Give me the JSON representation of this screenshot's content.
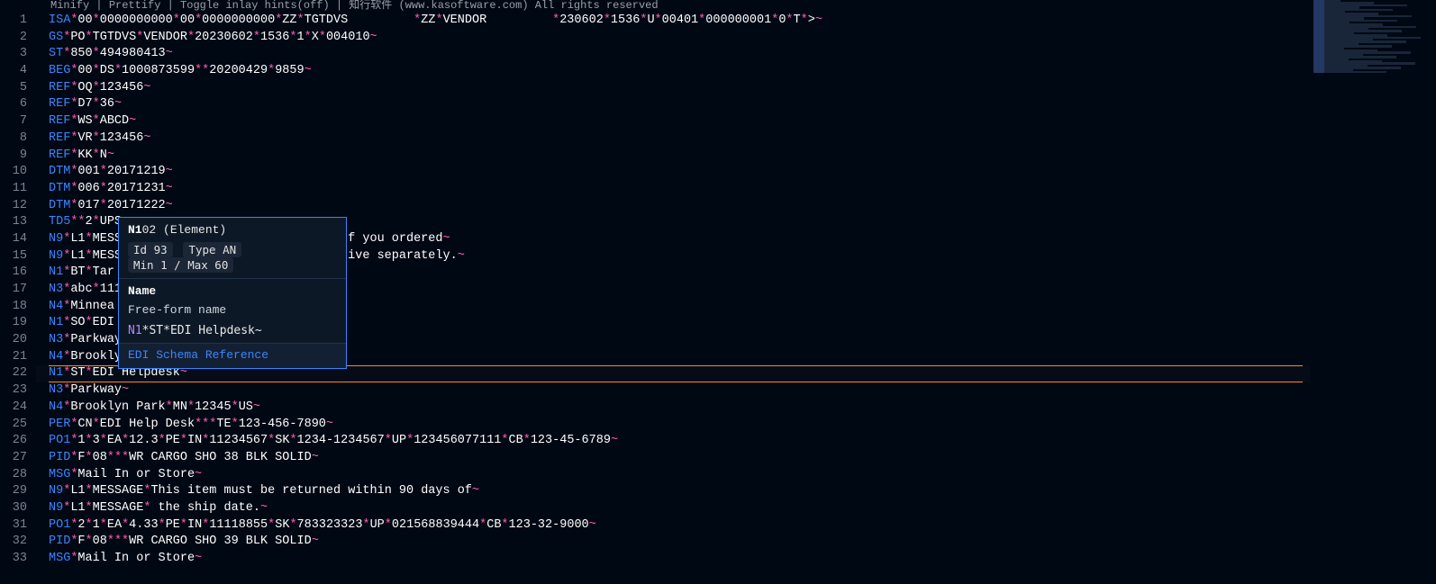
{
  "toolbar": {
    "minify": "Minify",
    "prettify": "Prettify",
    "inlay": "Toggle inlay hints(off)",
    "brand": "知行软件 (www.kasoftware.com) All rights reserved"
  },
  "hover": {
    "title_b": "N1",
    "title_rest": "02 (Element)",
    "badge_id": "Id 93",
    "badge_type": "Type AN",
    "badge_minmax": "Min 1 / Max 60",
    "label_name": "Name",
    "desc": "Free-form name",
    "example_seg": "N1",
    "example_rest": "*ST*EDI Helpdesk~",
    "link": "EDI Schema Reference"
  },
  "current_line_num": 22,
  "lines": [
    {
      "n": 1,
      "tokens": [
        [
          "seg",
          "ISA"
        ],
        [
          "s",
          "*"
        ],
        [
          "v",
          "00"
        ],
        [
          "s",
          "*"
        ],
        [
          "v",
          "0000000000"
        ],
        [
          "s",
          "*"
        ],
        [
          "v",
          "00"
        ],
        [
          "s",
          "*"
        ],
        [
          "v",
          "0000000000"
        ],
        [
          "s",
          "*"
        ],
        [
          "v",
          "ZZ"
        ],
        [
          "s",
          "*"
        ],
        [
          "v",
          "TGTDVS         "
        ],
        [
          "s",
          "*"
        ],
        [
          "v",
          "ZZ"
        ],
        [
          "s",
          "*"
        ],
        [
          "v",
          "VENDOR         "
        ],
        [
          "s",
          "*"
        ],
        [
          "v",
          "230602"
        ],
        [
          "s",
          "*"
        ],
        [
          "v",
          "1536"
        ],
        [
          "s",
          "*"
        ],
        [
          "v",
          "U"
        ],
        [
          "s",
          "*"
        ],
        [
          "v",
          "00401"
        ],
        [
          "s",
          "*"
        ],
        [
          "v",
          "000000001"
        ],
        [
          "s",
          "*"
        ],
        [
          "v",
          "0"
        ],
        [
          "s",
          "*"
        ],
        [
          "v",
          "T"
        ],
        [
          "s",
          "*"
        ],
        [
          "v",
          ">"
        ],
        [
          "t",
          "~"
        ]
      ]
    },
    {
      "n": 2,
      "tokens": [
        [
          "seg",
          "GS"
        ],
        [
          "s",
          "*"
        ],
        [
          "v",
          "PO"
        ],
        [
          "s",
          "*"
        ],
        [
          "v",
          "TGTDVS"
        ],
        [
          "s",
          "*"
        ],
        [
          "v",
          "VENDOR"
        ],
        [
          "s",
          "*"
        ],
        [
          "v",
          "20230602"
        ],
        [
          "s",
          "*"
        ],
        [
          "v",
          "1536"
        ],
        [
          "s",
          "*"
        ],
        [
          "v",
          "1"
        ],
        [
          "s",
          "*"
        ],
        [
          "v",
          "X"
        ],
        [
          "s",
          "*"
        ],
        [
          "v",
          "004010"
        ],
        [
          "t",
          "~"
        ]
      ]
    },
    {
      "n": 3,
      "tokens": [
        [
          "seg",
          "ST"
        ],
        [
          "s",
          "*"
        ],
        [
          "v",
          "850"
        ],
        [
          "s",
          "*"
        ],
        [
          "v",
          "494980413"
        ],
        [
          "t",
          "~"
        ]
      ]
    },
    {
      "n": 4,
      "tokens": [
        [
          "seg",
          "BEG"
        ],
        [
          "s",
          "*"
        ],
        [
          "v",
          "00"
        ],
        [
          "s",
          "*"
        ],
        [
          "v",
          "DS"
        ],
        [
          "s",
          "*"
        ],
        [
          "v",
          "1000873599"
        ],
        [
          "s",
          "**"
        ],
        [
          "v",
          "20200429"
        ],
        [
          "s",
          "*"
        ],
        [
          "v",
          "9859"
        ],
        [
          "t",
          "~"
        ]
      ]
    },
    {
      "n": 5,
      "tokens": [
        [
          "seg",
          "REF"
        ],
        [
          "s",
          "*"
        ],
        [
          "v",
          "OQ"
        ],
        [
          "s",
          "*"
        ],
        [
          "v",
          "123456"
        ],
        [
          "t",
          "~"
        ]
      ]
    },
    {
      "n": 6,
      "tokens": [
        [
          "seg",
          "REF"
        ],
        [
          "s",
          "*"
        ],
        [
          "v",
          "D7"
        ],
        [
          "s",
          "*"
        ],
        [
          "v",
          "36"
        ],
        [
          "t",
          "~"
        ]
      ]
    },
    {
      "n": 7,
      "tokens": [
        [
          "seg",
          "REF"
        ],
        [
          "s",
          "*"
        ],
        [
          "v",
          "WS"
        ],
        [
          "s",
          "*"
        ],
        [
          "v",
          "ABCD"
        ],
        [
          "t",
          "~"
        ]
      ]
    },
    {
      "n": 8,
      "tokens": [
        [
          "seg",
          "REF"
        ],
        [
          "s",
          "*"
        ],
        [
          "v",
          "VR"
        ],
        [
          "s",
          "*"
        ],
        [
          "v",
          "123456"
        ],
        [
          "t",
          "~"
        ]
      ]
    },
    {
      "n": 9,
      "tokens": [
        [
          "seg",
          "REF"
        ],
        [
          "s",
          "*"
        ],
        [
          "v",
          "KK"
        ],
        [
          "s",
          "*"
        ],
        [
          "v",
          "N"
        ],
        [
          "t",
          "~"
        ]
      ]
    },
    {
      "n": 10,
      "tokens": [
        [
          "seg",
          "DTM"
        ],
        [
          "s",
          "*"
        ],
        [
          "v",
          "001"
        ],
        [
          "s",
          "*"
        ],
        [
          "v",
          "20171219"
        ],
        [
          "t",
          "~"
        ]
      ]
    },
    {
      "n": 11,
      "tokens": [
        [
          "seg",
          "DTM"
        ],
        [
          "s",
          "*"
        ],
        [
          "v",
          "006"
        ],
        [
          "s",
          "*"
        ],
        [
          "v",
          "20171231"
        ],
        [
          "t",
          "~"
        ]
      ]
    },
    {
      "n": 12,
      "tokens": [
        [
          "seg",
          "DTM"
        ],
        [
          "s",
          "*"
        ],
        [
          "v",
          "017"
        ],
        [
          "s",
          "*"
        ],
        [
          "v",
          "20171222"
        ],
        [
          "t",
          "~"
        ]
      ]
    },
    {
      "n": 13,
      "tokens": [
        [
          "seg",
          "TD5"
        ],
        [
          "s",
          "**"
        ],
        [
          "v",
          "2"
        ],
        [
          "s",
          "*"
        ],
        [
          "v",
          "UPS"
        ]
      ]
    },
    {
      "n": 14,
      "tokens": [
        [
          "seg",
          "N9"
        ],
        [
          "s",
          "*"
        ],
        [
          "v",
          "L1"
        ],
        [
          "s",
          "*"
        ],
        [
          "v",
          "MESS                              If you ordered"
        ],
        [
          "t",
          "~"
        ]
      ]
    },
    {
      "n": 15,
      "tokens": [
        [
          "seg",
          "N9"
        ],
        [
          "s",
          "*"
        ],
        [
          "v",
          "L1"
        ],
        [
          "s",
          "*"
        ],
        [
          "v",
          "MESS                              rive separately."
        ],
        [
          "t",
          "~"
        ]
      ]
    },
    {
      "n": 16,
      "tokens": [
        [
          "seg",
          "N1"
        ],
        [
          "s",
          "*"
        ],
        [
          "v",
          "BT"
        ],
        [
          "s",
          "*"
        ],
        [
          "v",
          "Tar"
        ]
      ]
    },
    {
      "n": 17,
      "tokens": [
        [
          "seg",
          "N3"
        ],
        [
          "s",
          "*"
        ],
        [
          "v",
          "abc"
        ],
        [
          "s",
          "*"
        ],
        [
          "v",
          "111"
        ]
      ]
    },
    {
      "n": 18,
      "tokens": [
        [
          "seg",
          "N4"
        ],
        [
          "s",
          "*"
        ],
        [
          "v",
          "Minnea"
        ]
      ]
    },
    {
      "n": 19,
      "tokens": [
        [
          "seg",
          "N1"
        ],
        [
          "s",
          "*"
        ],
        [
          "v",
          "SO"
        ],
        [
          "s",
          "*"
        ],
        [
          "v",
          "EDI"
        ]
      ]
    },
    {
      "n": 20,
      "tokens": [
        [
          "seg",
          "N3"
        ],
        [
          "s",
          "*"
        ],
        [
          "v",
          "Parkway"
        ]
      ]
    },
    {
      "n": 21,
      "tokens": [
        [
          "seg",
          "N4"
        ],
        [
          "s",
          "*"
        ],
        [
          "v",
          "Brookly"
        ]
      ]
    },
    {
      "n": 22,
      "tokens": [
        [
          "seg",
          "N1"
        ],
        [
          "s",
          "*"
        ],
        [
          "v",
          "ST"
        ],
        [
          "s",
          "*"
        ],
        [
          "v",
          "EDI Helpdesk"
        ],
        [
          "t",
          "~"
        ]
      ]
    },
    {
      "n": 23,
      "tokens": [
        [
          "seg",
          "N3"
        ],
        [
          "s",
          "*"
        ],
        [
          "v",
          "Parkway"
        ],
        [
          "t",
          "~"
        ]
      ]
    },
    {
      "n": 24,
      "tokens": [
        [
          "seg",
          "N4"
        ],
        [
          "s",
          "*"
        ],
        [
          "v",
          "Brooklyn Park"
        ],
        [
          "s",
          "*"
        ],
        [
          "v",
          "MN"
        ],
        [
          "s",
          "*"
        ],
        [
          "v",
          "12345"
        ],
        [
          "s",
          "*"
        ],
        [
          "v",
          "US"
        ],
        [
          "t",
          "~"
        ]
      ]
    },
    {
      "n": 25,
      "tokens": [
        [
          "seg",
          "PER"
        ],
        [
          "s",
          "*"
        ],
        [
          "v",
          "CN"
        ],
        [
          "s",
          "*"
        ],
        [
          "v",
          "EDI Help Desk"
        ],
        [
          "s",
          "***"
        ],
        [
          "v",
          "TE"
        ],
        [
          "s",
          "*"
        ],
        [
          "v",
          "123-456-7890"
        ],
        [
          "t",
          "~"
        ]
      ]
    },
    {
      "n": 26,
      "tokens": [
        [
          "seg",
          "PO1"
        ],
        [
          "s",
          "*"
        ],
        [
          "v",
          "1"
        ],
        [
          "s",
          "*"
        ],
        [
          "v",
          "3"
        ],
        [
          "s",
          "*"
        ],
        [
          "v",
          "EA"
        ],
        [
          "s",
          "*"
        ],
        [
          "v",
          "12.3"
        ],
        [
          "s",
          "*"
        ],
        [
          "v",
          "PE"
        ],
        [
          "s",
          "*"
        ],
        [
          "v",
          "IN"
        ],
        [
          "s",
          "*"
        ],
        [
          "v",
          "11234567"
        ],
        [
          "s",
          "*"
        ],
        [
          "v",
          "SK"
        ],
        [
          "s",
          "*"
        ],
        [
          "v",
          "1234-1234567"
        ],
        [
          "s",
          "*"
        ],
        [
          "v",
          "UP"
        ],
        [
          "s",
          "*"
        ],
        [
          "v",
          "123456077111"
        ],
        [
          "s",
          "*"
        ],
        [
          "v",
          "CB"
        ],
        [
          "s",
          "*"
        ],
        [
          "v",
          "123-45-6789"
        ],
        [
          "t",
          "~"
        ]
      ]
    },
    {
      "n": 27,
      "tokens": [
        [
          "seg",
          "PID"
        ],
        [
          "s",
          "*"
        ],
        [
          "v",
          "F"
        ],
        [
          "s",
          "*"
        ],
        [
          "v",
          "08"
        ],
        [
          "s",
          "***"
        ],
        [
          "v",
          "WR CARGO SHO 38 BLK SOLID"
        ],
        [
          "t",
          "~"
        ]
      ]
    },
    {
      "n": 28,
      "tokens": [
        [
          "seg",
          "MSG"
        ],
        [
          "s",
          "*"
        ],
        [
          "v",
          "Mail In or Store"
        ],
        [
          "t",
          "~"
        ]
      ]
    },
    {
      "n": 29,
      "tokens": [
        [
          "seg",
          "N9"
        ],
        [
          "s",
          "*"
        ],
        [
          "v",
          "L1"
        ],
        [
          "s",
          "*"
        ],
        [
          "v",
          "MESSAGE"
        ],
        [
          "s",
          "*"
        ],
        [
          "v",
          "This item must be returned within 90 days of"
        ],
        [
          "t",
          "~"
        ]
      ]
    },
    {
      "n": 30,
      "tokens": [
        [
          "seg",
          "N9"
        ],
        [
          "s",
          "*"
        ],
        [
          "v",
          "L1"
        ],
        [
          "s",
          "*"
        ],
        [
          "v",
          "MESSAGE"
        ],
        [
          "s",
          "*"
        ],
        [
          "v",
          " the ship date."
        ],
        [
          "t",
          "~"
        ]
      ]
    },
    {
      "n": 31,
      "tokens": [
        [
          "seg",
          "PO1"
        ],
        [
          "s",
          "*"
        ],
        [
          "v",
          "2"
        ],
        [
          "s",
          "*"
        ],
        [
          "v",
          "1"
        ],
        [
          "s",
          "*"
        ],
        [
          "v",
          "EA"
        ],
        [
          "s",
          "*"
        ],
        [
          "v",
          "4.33"
        ],
        [
          "s",
          "*"
        ],
        [
          "v",
          "PE"
        ],
        [
          "s",
          "*"
        ],
        [
          "v",
          "IN"
        ],
        [
          "s",
          "*"
        ],
        [
          "v",
          "11118855"
        ],
        [
          "s",
          "*"
        ],
        [
          "v",
          "SK"
        ],
        [
          "s",
          "*"
        ],
        [
          "v",
          "783323323"
        ],
        [
          "s",
          "*"
        ],
        [
          "v",
          "UP"
        ],
        [
          "s",
          "*"
        ],
        [
          "v",
          "021568839444"
        ],
        [
          "s",
          "*"
        ],
        [
          "v",
          "CB"
        ],
        [
          "s",
          "*"
        ],
        [
          "v",
          "123-32-9000"
        ],
        [
          "t",
          "~"
        ]
      ]
    },
    {
      "n": 32,
      "tokens": [
        [
          "seg",
          "PID"
        ],
        [
          "s",
          "*"
        ],
        [
          "v",
          "F"
        ],
        [
          "s",
          "*"
        ],
        [
          "v",
          "08"
        ],
        [
          "s",
          "***"
        ],
        [
          "v",
          "WR CARGO SHO 39 BLK SOLID"
        ],
        [
          "t",
          "~"
        ]
      ]
    },
    {
      "n": 33,
      "tokens": [
        [
          "seg",
          "MSG"
        ],
        [
          "s",
          "*"
        ],
        [
          "v",
          "Mail In or Store"
        ],
        [
          "t",
          "~"
        ]
      ]
    }
  ]
}
